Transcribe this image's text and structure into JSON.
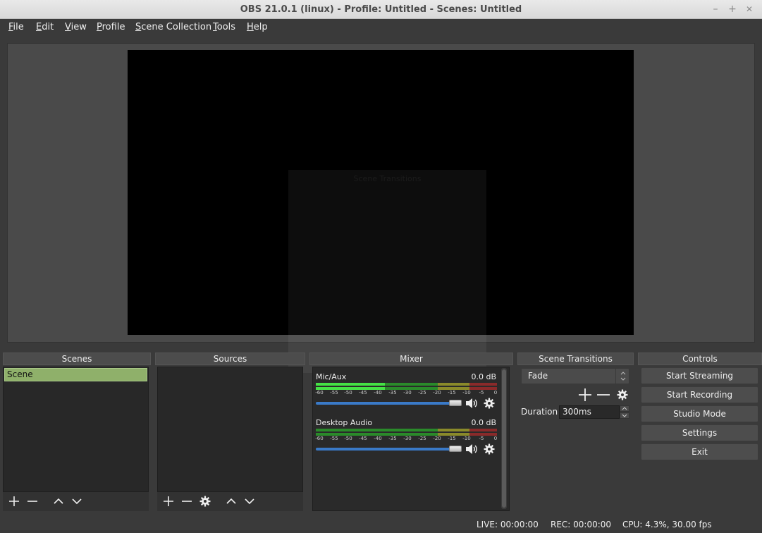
{
  "window": {
    "title": "OBS 21.0.1 (linux) - Profile: Untitled - Scenes: Untitled",
    "minimize": "–",
    "maximize": "+",
    "close": "✕"
  },
  "menu": [
    {
      "label": "File",
      "u": "F",
      "rest": "ile"
    },
    {
      "label": "Edit",
      "u": "E",
      "rest": "dit"
    },
    {
      "label": "View",
      "u": "V",
      "rest": "iew"
    },
    {
      "label": "Profile",
      "u": "P",
      "rest": "rofile"
    },
    {
      "label": "Scene Collection",
      "u": "S",
      "rest": "cene Collection"
    },
    {
      "label": "Tools",
      "u": "T",
      "rest": "ools"
    },
    {
      "label": "Help",
      "u": "H",
      "rest": "elp"
    }
  ],
  "preview": {
    "overlay_title": "Scene Transitions"
  },
  "docks": {
    "scenes": {
      "title": "Scenes",
      "items": [
        "Scene"
      ]
    },
    "sources": {
      "title": "Sources"
    },
    "mixer": {
      "title": "Mixer"
    },
    "transitions": {
      "title": "Scene Transitions"
    },
    "controls": {
      "title": "Controls"
    }
  },
  "mixer": {
    "tick_labels": [
      "-60",
      "-55",
      "-50",
      "-45",
      "-40",
      "-35",
      "-30",
      "-25",
      "-20",
      "-15",
      "-10",
      "-5",
      "0"
    ],
    "channels": [
      {
        "name": "Mic/Aux",
        "db": "0.0 dB",
        "volume": 1.0
      },
      {
        "name": "Desktop Audio",
        "db": "0.0 dB",
        "volume": 1.0
      }
    ]
  },
  "transitions": {
    "selected": "Fade",
    "duration_label": "Duration",
    "duration_value": "300ms"
  },
  "controls": {
    "start_streaming": "Start Streaming",
    "start_recording": "Start Recording",
    "studio_mode": "Studio Mode",
    "settings": "Settings",
    "exit": "Exit"
  },
  "status": {
    "live": "LIVE: 00:00:00",
    "rec": "REC: 00:00:00",
    "cpu": "CPU: 4.3%, 30.00 fps"
  },
  "icons": {
    "add": "plus-icon",
    "remove": "minus-icon",
    "up": "chevron-up-icon",
    "down": "chevron-down-icon",
    "settings": "gear-icon",
    "volume": "speaker-icon"
  },
  "colors": {
    "scene_selected": "#8fb06a",
    "slider": "#3a7ac8",
    "meter_green": "#3fcf3f",
    "meter_yellow": "#c8c83a",
    "meter_red": "#c83a3a"
  }
}
